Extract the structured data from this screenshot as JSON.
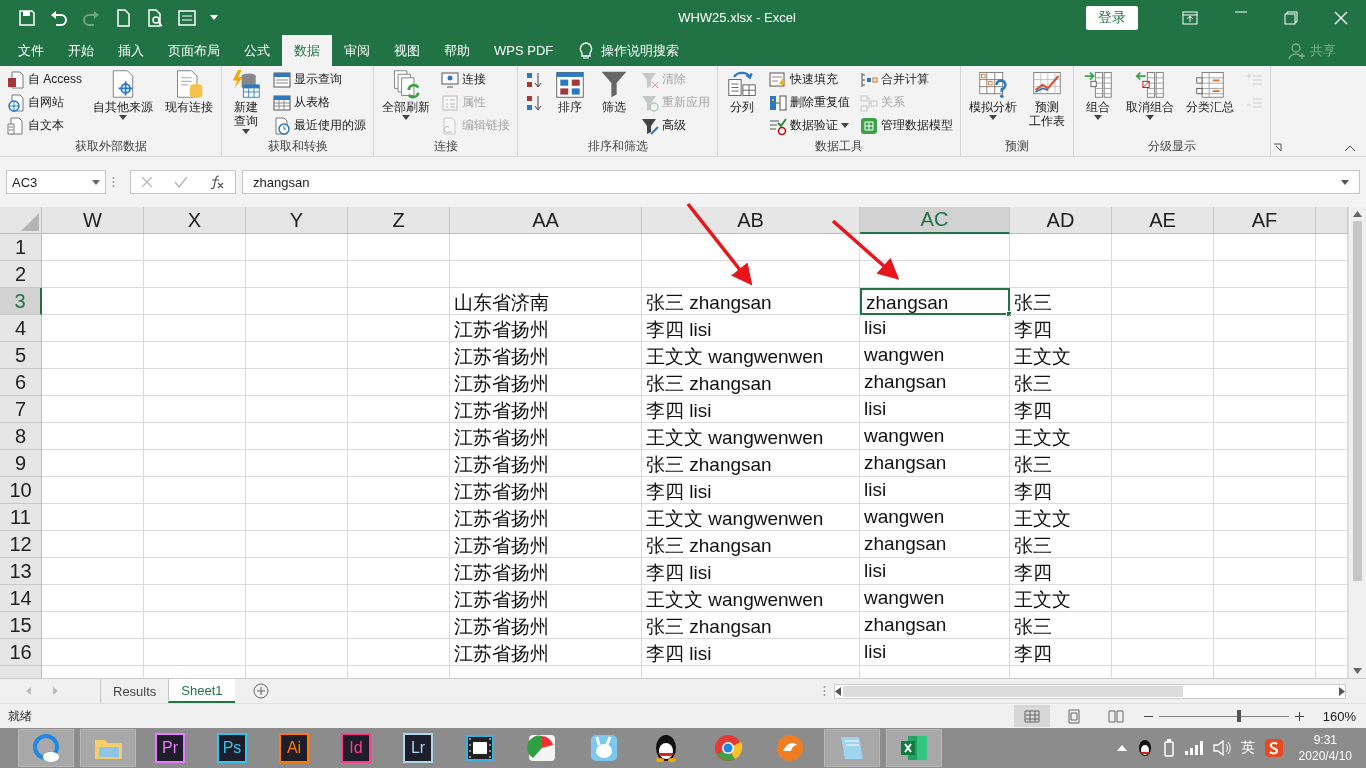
{
  "title_bar": {
    "title": "WHW25.xlsx  -  Excel",
    "login": "登录",
    "quick_access": [
      {
        "disabled": false
      },
      {
        "disabled": false
      },
      {
        "disabled": true
      },
      {
        "disabled": false
      },
      {
        "disabled": false
      },
      {
        "disabled": false
      }
    ]
  },
  "menu_tabs": [
    {
      "label": "文件",
      "selected": false
    },
    {
      "label": "开始",
      "selected": false
    },
    {
      "label": "插入",
      "selected": false
    },
    {
      "label": "页面布局",
      "selected": false
    },
    {
      "label": "公式",
      "selected": false
    },
    {
      "label": "数据",
      "selected": true
    },
    {
      "label": "审阅",
      "selected": false
    },
    {
      "label": "视图",
      "selected": false
    },
    {
      "label": "帮助",
      "selected": false
    },
    {
      "label": "WPS PDF",
      "selected": false
    }
  ],
  "tell_me": "操作说明搜索",
  "share": "共享",
  "ribbon": {
    "groups": [
      {
        "label": "获取外部数据",
        "columns": [
          {
            "kind": "stack",
            "items": [
              {
                "label": "自 Access",
                "disabled": false,
                "dropdown": false
              },
              {
                "label": "自网站",
                "disabled": false,
                "dropdown": false
              },
              {
                "label": "自文本",
                "disabled": false,
                "dropdown": false
              }
            ]
          },
          {
            "kind": "large",
            "lines": [
              "自其他来源"
            ],
            "disabled": false,
            "dropdown": true
          },
          {
            "kind": "large",
            "lines": [
              "现有连接"
            ],
            "disabled": false,
            "dropdown": false
          }
        ]
      },
      {
        "label": "获取和转换",
        "columns": [
          {
            "kind": "large",
            "lines": [
              "新建",
              "查询"
            ],
            "disabled": false,
            "dropdown": true
          },
          {
            "kind": "stack",
            "items": [
              {
                "label": "显示查询",
                "disabled": false,
                "dropdown": false
              },
              {
                "label": "从表格",
                "disabled": false,
                "dropdown": false
              },
              {
                "label": "最近使用的源",
                "disabled": false,
                "dropdown": false
              }
            ]
          }
        ]
      },
      {
        "label": "连接",
        "columns": [
          {
            "kind": "large",
            "lines": [
              "全部刷新"
            ],
            "disabled": false,
            "dropdown": true
          },
          {
            "kind": "stack",
            "items": [
              {
                "label": "连接",
                "disabled": false,
                "dropdown": false
              },
              {
                "label": "属性",
                "disabled": true,
                "dropdown": false
              },
              {
                "label": "编辑链接",
                "disabled": true,
                "dropdown": false
              }
            ]
          }
        ]
      },
      {
        "label": "排序和筛选",
        "columns": [
          {
            "kind": "stack",
            "items": [
              {
                "disabled": false,
                "dropdown": false
              },
              {
                "disabled": false,
                "dropdown": false
              }
            ]
          },
          {
            "kind": "large",
            "lines": [
              "排序"
            ],
            "disabled": false,
            "dropdown": false
          },
          {
            "kind": "large",
            "lines": [
              "筛选"
            ],
            "disabled": false,
            "dropdown": false
          },
          {
            "kind": "stack",
            "items": [
              {
                "label": "清除",
                "disabled": true,
                "dropdown": false
              },
              {
                "label": "重新应用",
                "disabled": true,
                "dropdown": false
              },
              {
                "label": "高级",
                "disabled": false,
                "dropdown": false
              }
            ]
          }
        ]
      },
      {
        "label": "数据工具",
        "columns": [
          {
            "kind": "large",
            "lines": [
              "分列"
            ],
            "disabled": false,
            "dropdown": false
          },
          {
            "kind": "stack",
            "items": [
              {
                "label": "快速填充",
                "disabled": false,
                "dropdown": false
              },
              {
                "label": "删除重复值",
                "disabled": false,
                "dropdown": false
              },
              {
                "label": "数据验证",
                "disabled": false,
                "dropdown": true
              }
            ]
          },
          {
            "kind": "stack",
            "items": [
              {
                "label": "合并计算",
                "disabled": false,
                "dropdown": false
              },
              {
                "label": "关系",
                "disabled": true,
                "dropdown": false
              },
              {
                "label": "管理数据模型",
                "disabled": false,
                "dropdown": false
              }
            ]
          }
        ]
      },
      {
        "label": "预测",
        "columns": [
          {
            "kind": "large",
            "lines": [
              "模拟分析"
            ],
            "disabled": false,
            "dropdown": true
          },
          {
            "kind": "large",
            "lines": [
              "预测",
              "工作表"
            ],
            "disabled": false,
            "dropdown": false
          }
        ]
      },
      {
        "label": "分级显示",
        "columns": [
          {
            "kind": "large",
            "lines": [
              "组合"
            ],
            "disabled": false,
            "dropdown": true
          },
          {
            "kind": "large",
            "lines": [
              "取消组合"
            ],
            "disabled": false,
            "dropdown": true
          },
          {
            "kind": "large",
            "lines": [
              "分类汇总"
            ],
            "disabled": false,
            "dropdown": false
          },
          {
            "kind": "stack",
            "items": [
              {
                "disabled": true,
                "dropdown": false
              },
              {
                "disabled": true,
                "dropdown": false
              }
            ]
          }
        ]
      }
    ]
  },
  "formula_bar": {
    "name_box": "AC3",
    "formula": "zhangsan"
  },
  "sheet": {
    "columns": [
      {
        "label": "W",
        "selected": false
      },
      {
        "label": "X",
        "selected": false
      },
      {
        "label": "Y",
        "selected": false
      },
      {
        "label": "Z",
        "selected": false
      },
      {
        "label": "AA",
        "selected": false
      },
      {
        "label": "AB",
        "selected": false
      },
      {
        "label": "AC",
        "selected": true
      },
      {
        "label": "AD",
        "selected": false
      },
      {
        "label": "AE",
        "selected": false
      },
      {
        "label": "AF",
        "selected": false
      }
    ],
    "rows": [
      {
        "number": "1",
        "selected": false
      },
      {
        "number": "2",
        "selected": false
      },
      {
        "number": "3",
        "selected": true,
        "cells": [
          "山东省济南",
          "张三 zhangsan",
          "zhangsan",
          "张三"
        ]
      },
      {
        "number": "4",
        "selected": false,
        "cells": [
          "江苏省扬州",
          "李四 lisi",
          "lisi",
          "李四"
        ]
      },
      {
        "number": "5",
        "selected": false,
        "cells": [
          "江苏省扬州",
          "王文文 wangwenwen",
          "wangwen",
          "王文文"
        ]
      },
      {
        "number": "6",
        "selected": false,
        "cells": [
          "江苏省扬州",
          "张三 zhangsan",
          "zhangsan",
          "张三"
        ]
      },
      {
        "number": "7",
        "selected": false,
        "cells": [
          "江苏省扬州",
          "李四 lisi",
          "lisi",
          "李四"
        ]
      },
      {
        "number": "8",
        "selected": false,
        "cells": [
          "江苏省扬州",
          "王文文 wangwenwen",
          "wangwen",
          "王文文"
        ]
      },
      {
        "number": "9",
        "selected": false,
        "cells": [
          "江苏省扬州",
          "张三 zhangsan",
          "zhangsan",
          "张三"
        ]
      },
      {
        "number": "10",
        "selected": false,
        "cells": [
          "江苏省扬州",
          "李四 lisi",
          "lisi",
          "李四"
        ]
      },
      {
        "number": "11",
        "selected": false,
        "cells": [
          "江苏省扬州",
          "王文文 wangwenwen",
          "wangwen",
          "王文文"
        ]
      },
      {
        "number": "12",
        "selected": false,
        "cells": [
          "江苏省扬州",
          "张三 zhangsan",
          "zhangsan",
          "张三"
        ]
      },
      {
        "number": "13",
        "selected": false,
        "cells": [
          "江苏省扬州",
          "李四 lisi",
          "lisi",
          "李四"
        ]
      },
      {
        "number": "14",
        "selected": false,
        "cells": [
          "江苏省扬州",
          "王文文 wangwenwen",
          "wangwen",
          "王文文"
        ]
      },
      {
        "number": "15",
        "selected": false,
        "cells": [
          "江苏省扬州",
          "张三 zhangsan",
          "zhangsan",
          "张三"
        ]
      },
      {
        "number": "16",
        "selected": false,
        "cells": [
          "江苏省扬州",
          "李四 lisi",
          "lisi",
          "李四"
        ]
      }
    ]
  },
  "sheet_tabs": [
    {
      "label": "Results",
      "selected": false
    },
    {
      "label": "Sheet1",
      "selected": true
    }
  ],
  "status_bar": {
    "status": "就绪",
    "views": [
      {
        "selected": true
      },
      {
        "selected": false
      },
      {
        "selected": false
      }
    ],
    "zoom": "160%",
    "zoom_level": {
      "level": 0.62
    }
  },
  "taskbar": {
    "items": [
      {
        "kind": "icon",
        "running": true
      },
      {
        "kind": "icon",
        "running": true
      },
      {
        "kind": "label",
        "label": "Pr",
        "color": "#e77bff",
        "running": false
      },
      {
        "kind": "label",
        "label": "Ps",
        "color": "#31c5f0",
        "running": false
      },
      {
        "kind": "label",
        "label": "Ai",
        "color": "#ff7c00",
        "running": false
      },
      {
        "kind": "label",
        "label": "Id",
        "color": "#ff3d8b",
        "running": false
      },
      {
        "kind": "label",
        "label": "Lr",
        "color": "#add5ec",
        "running": false
      },
      {
        "kind": "icon",
        "running": false
      },
      {
        "kind": "icon",
        "running": false
      },
      {
        "kind": "icon",
        "running": false
      },
      {
        "kind": "icon",
        "running": false
      },
      {
        "kind": "icon",
        "running": false
      },
      {
        "kind": "icon",
        "running": false
      },
      {
        "kind": "icon",
        "running": true
      },
      {
        "kind": "icon",
        "running": true
      }
    ],
    "ime": "英",
    "time": "9:31",
    "date": "2020/4/10"
  }
}
